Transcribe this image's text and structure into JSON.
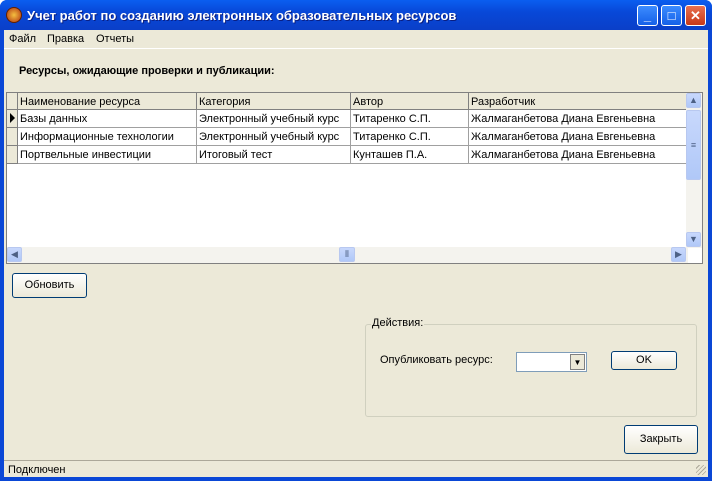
{
  "window": {
    "title": "Учет работ по созданию электронных образовательных ресурсов"
  },
  "menu": [
    "Файл",
    "Правка",
    "Отчеты"
  ],
  "heading": "Ресурсы, ожидающие проверки и публикации:",
  "table": {
    "columns": [
      "Наименование ресурса",
      "Категория",
      "Автор",
      "Разработчик"
    ],
    "rows": [
      [
        "Базы данных",
        "Электронный учебный курс",
        "Титаренко С.П.",
        "Жалмаганбетова Диана Евгеньевна"
      ],
      [
        "Информационные технологии",
        "Электронный учебный курс",
        "Титаренко С.П.",
        "Жалмаганбетова Диана Евгеньевна"
      ],
      [
        "Портвельные инвестиции",
        "Итоговый тест",
        "Кунташев П.А.",
        "Жалмаганбетова Диана Евгеньевна"
      ]
    ]
  },
  "buttons": {
    "refresh": "Обновить",
    "ok": "OK",
    "close": "Закрыть"
  },
  "actions": {
    "group_label": "Действия:",
    "publish_label": "Опубликовать ресурс:",
    "publish_value": ""
  },
  "status": "Подключен"
}
